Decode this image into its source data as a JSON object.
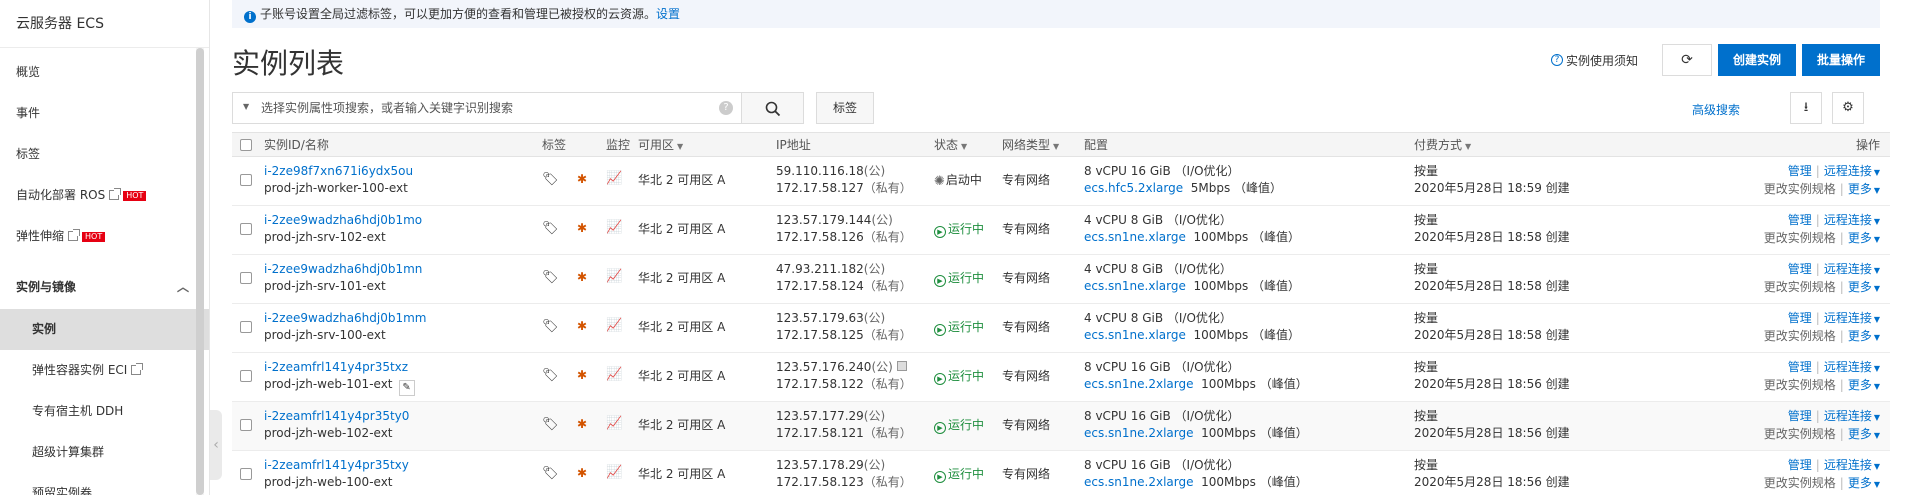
{
  "sidebar": {
    "title": "云服务器 ECS",
    "items": [
      {
        "label": "概览"
      },
      {
        "label": "事件"
      },
      {
        "label": "标签"
      },
      {
        "label": "自动化部署 ROS",
        "hot": "HOT"
      },
      {
        "label": "弹性伸缩",
        "hot": "HOT"
      }
    ],
    "section": {
      "label": "实例与镜像"
    },
    "sub_items": [
      {
        "label": "实例"
      },
      {
        "label": "弹性容器实例 ECI"
      },
      {
        "label": "专有宿主机 DDH"
      },
      {
        "label": "超级计算集群"
      },
      {
        "label": "预留实例券"
      }
    ]
  },
  "notice": {
    "text": "子账号设置全局过滤标签，可以更加方便的查看和管理已被授权的云资源。",
    "link": "设置"
  },
  "header": {
    "title": "实例列表",
    "help": "实例使用须知",
    "create_label": "创建实例",
    "batch_label": "批量操作"
  },
  "search": {
    "placeholder": "选择实例属性项搜索，或者输入关键字识别搜索",
    "tag_label": "标签",
    "advanced_label": "高级搜索"
  },
  "table": {
    "columns": {
      "id": "实例ID/名称",
      "tag": "标签",
      "monitor": "监控",
      "zone": "可用区",
      "ip": "IP地址",
      "status": "状态",
      "network": "网络类型",
      "config": "配置",
      "payment": "付费方式",
      "ops": "操作"
    },
    "rows": [
      {
        "id": "i-2ze98f7xn671i6ydx5ou",
        "name": "prod-jzh-worker-100-ext",
        "zone": "华北 2 可用区 A",
        "ip_pub": "59.110.116.18",
        "ip_pub_suffix": "(公)",
        "ip_priv": "172.17.58.127",
        "ip_priv_suffix": "（私有）",
        "status": "启动中",
        "status_kind": "starting",
        "network": "专有网络",
        "cfg": "8 vCPU 16 GiB （I/O优化）",
        "spec": "ecs.hfc5.2xlarge",
        "bw": "5Mbps （峰值）",
        "pay": "按量",
        "created": "2020年5月28日 18:59 创建"
      },
      {
        "id": "i-2zee9wadzha6hdj0b1mo",
        "name": "prod-jzh-srv-102-ext",
        "zone": "华北 2 可用区 A",
        "ip_pub": "123.57.179.144",
        "ip_pub_suffix": "(公)",
        "ip_priv": "172.17.58.126",
        "ip_priv_suffix": "（私有）",
        "status": "运行中",
        "status_kind": "running",
        "network": "专有网络",
        "cfg": "4 vCPU 8 GiB （I/O优化）",
        "spec": "ecs.sn1ne.xlarge",
        "bw": "100Mbps （峰值）",
        "pay": "按量",
        "created": "2020年5月28日 18:58 创建"
      },
      {
        "id": "i-2zee9wadzha6hdj0b1mn",
        "name": "prod-jzh-srv-101-ext",
        "zone": "华北 2 可用区 A",
        "ip_pub": "47.93.211.182",
        "ip_pub_suffix": "(公)",
        "ip_priv": "172.17.58.124",
        "ip_priv_suffix": "（私有）",
        "status": "运行中",
        "status_kind": "running",
        "network": "专有网络",
        "cfg": "4 vCPU 8 GiB （I/O优化）",
        "spec": "ecs.sn1ne.xlarge",
        "bw": "100Mbps （峰值）",
        "pay": "按量",
        "created": "2020年5月28日 18:58 创建"
      },
      {
        "id": "i-2zee9wadzha6hdj0b1mm",
        "name": "prod-jzh-srv-100-ext",
        "zone": "华北 2 可用区 A",
        "ip_pub": "123.57.179.63",
        "ip_pub_suffix": "(公)",
        "ip_priv": "172.17.58.125",
        "ip_priv_suffix": "（私有）",
        "status": "运行中",
        "status_kind": "running",
        "network": "专有网络",
        "cfg": "4 vCPU 8 GiB （I/O优化）",
        "spec": "ecs.sn1ne.xlarge",
        "bw": "100Mbps （峰值）",
        "pay": "按量",
        "created": "2020年5月28日 18:58 创建"
      },
      {
        "id": "i-2zeamfrl141y4pr35txz",
        "name": "prod-jzh-web-101-ext",
        "zone": "华北 2 可用区 A",
        "ip_pub": "123.57.176.240",
        "ip_pub_suffix": "(公)",
        "ip_priv": "172.17.58.122",
        "ip_priv_suffix": "（私有）",
        "status": "运行中",
        "status_kind": "running",
        "network": "专有网络",
        "cfg": "8 vCPU 16 GiB （I/O优化）",
        "spec": "ecs.sn1ne.2xlarge",
        "bw": "100Mbps （峰值）",
        "pay": "按量",
        "created": "2020年5月28日 18:56 创建"
      },
      {
        "id": "i-2zeamfrl141y4pr35ty0",
        "name": "prod-jzh-web-102-ext",
        "zone": "华北 2 可用区 A",
        "ip_pub": "123.57.177.29",
        "ip_pub_suffix": "(公)",
        "ip_priv": "172.17.58.121",
        "ip_priv_suffix": "（私有）",
        "status": "运行中",
        "status_kind": "running",
        "network": "专有网络",
        "cfg": "8 vCPU 16 GiB （I/O优化）",
        "spec": "ecs.sn1ne.2xlarge",
        "bw": "100Mbps （峰值）",
        "pay": "按量",
        "created": "2020年5月28日 18:56 创建"
      },
      {
        "id": "i-2zeamfrl141y4pr35txy",
        "name": "prod-jzh-web-100-ext",
        "zone": "华北 2 可用区 A",
        "ip_pub": "123.57.178.29",
        "ip_pub_suffix": "(公)",
        "ip_priv": "172.17.58.123",
        "ip_priv_suffix": "（私有）",
        "status": "运行中",
        "status_kind": "running",
        "network": "专有网络",
        "cfg": "8 vCPU 16 GiB （I/O优化）",
        "spec": "ecs.sn1ne.2xlarge",
        "bw": "100Mbps （峰值）",
        "pay": "按量",
        "created": "2020年5月28日 18:56 创建"
      }
    ],
    "ops": {
      "manage": "管理",
      "remote": "远程连接",
      "change_spec": "更改实例规格",
      "more": "更多"
    }
  },
  "colors": {
    "accent": "#0070cc",
    "running": "#1e8e3e",
    "hot": "#e60012"
  }
}
